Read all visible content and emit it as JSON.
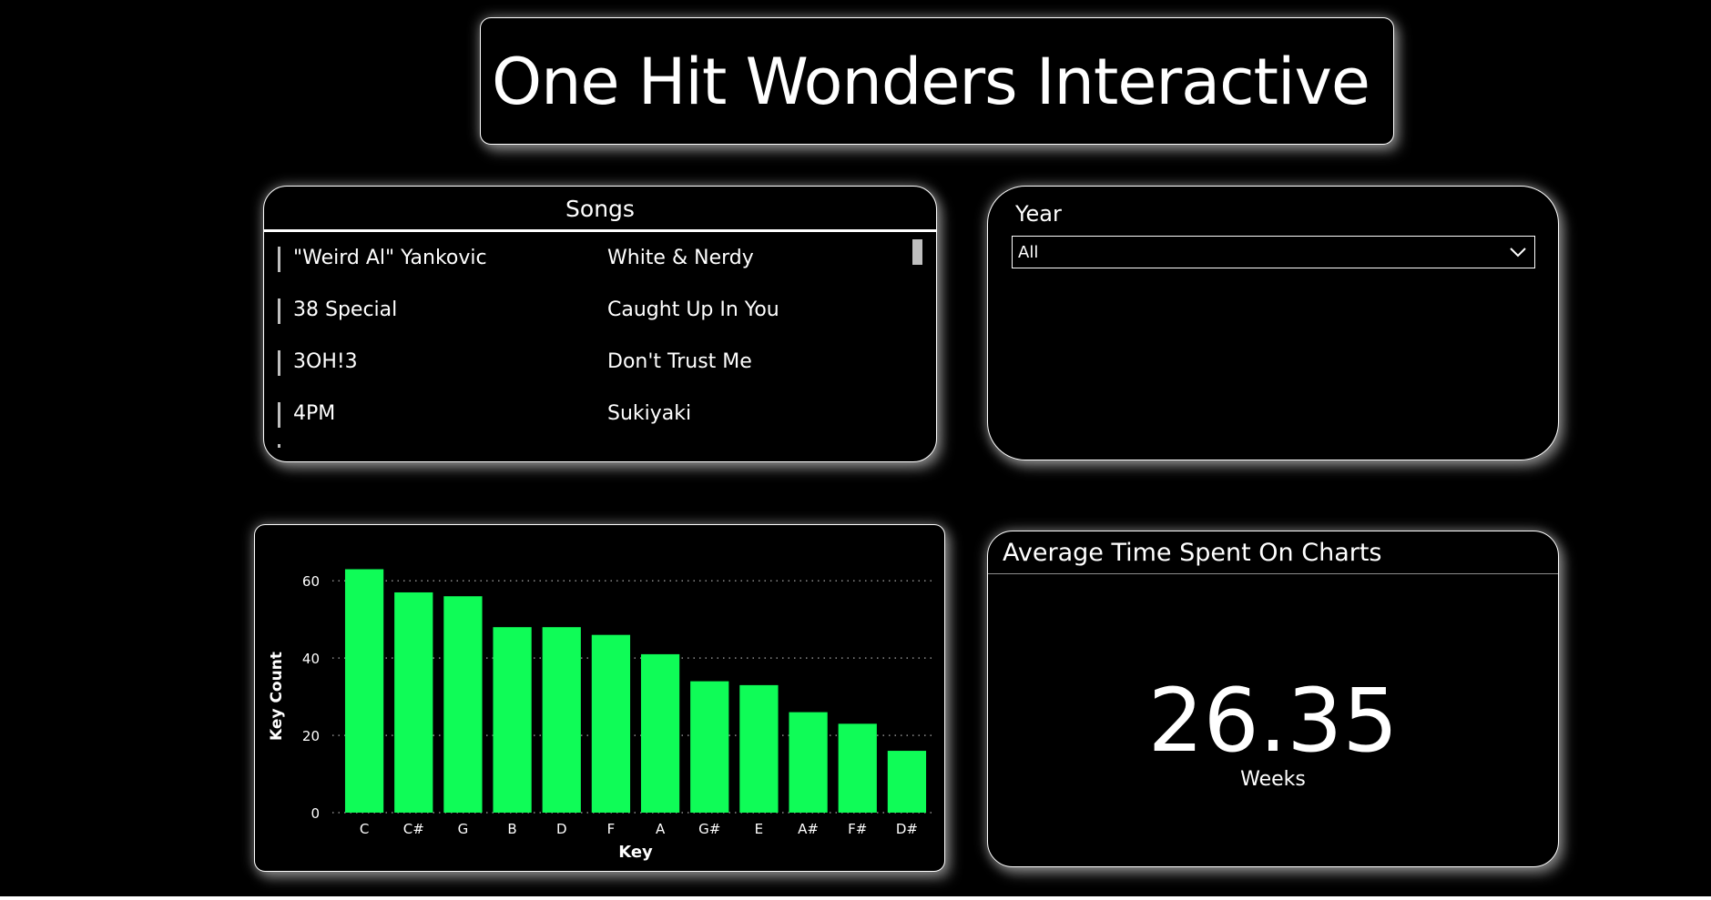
{
  "title": "One Hit Wonders Interactive",
  "songs": {
    "title": "Songs",
    "rows": [
      {
        "artist": "\"Weird Al\" Yankovic",
        "song": "White & Nerdy"
      },
      {
        "artist": "38 Special",
        "song": "Caught Up In You"
      },
      {
        "artist": "3OH!3",
        "song": "Don't Trust Me"
      },
      {
        "artist": "4PM",
        "song": "Sukiyaki"
      }
    ]
  },
  "year_filter": {
    "label": "Year",
    "selected": "All",
    "icon": "chevron-down-icon"
  },
  "kpi": {
    "title": "Average Time Spent On Charts",
    "value": "26.35",
    "unit": "Weeks"
  },
  "colors": {
    "background": "#000000",
    "foreground": "#ffffff",
    "bar": "#0ffc57",
    "gridline": "#8c8c8c"
  },
  "chart_data": {
    "type": "bar",
    "categories": [
      "C",
      "C#",
      "G",
      "B",
      "D",
      "F",
      "A",
      "G#",
      "E",
      "A#",
      "F#",
      "D#"
    ],
    "values": [
      63,
      57,
      56,
      48,
      48,
      46,
      41,
      34,
      33,
      26,
      23,
      16
    ],
    "xlabel": "Key",
    "ylabel": "Key Count",
    "ylim": [
      0,
      65
    ],
    "yticks": [
      0,
      20,
      40,
      60
    ],
    "grid": true
  }
}
